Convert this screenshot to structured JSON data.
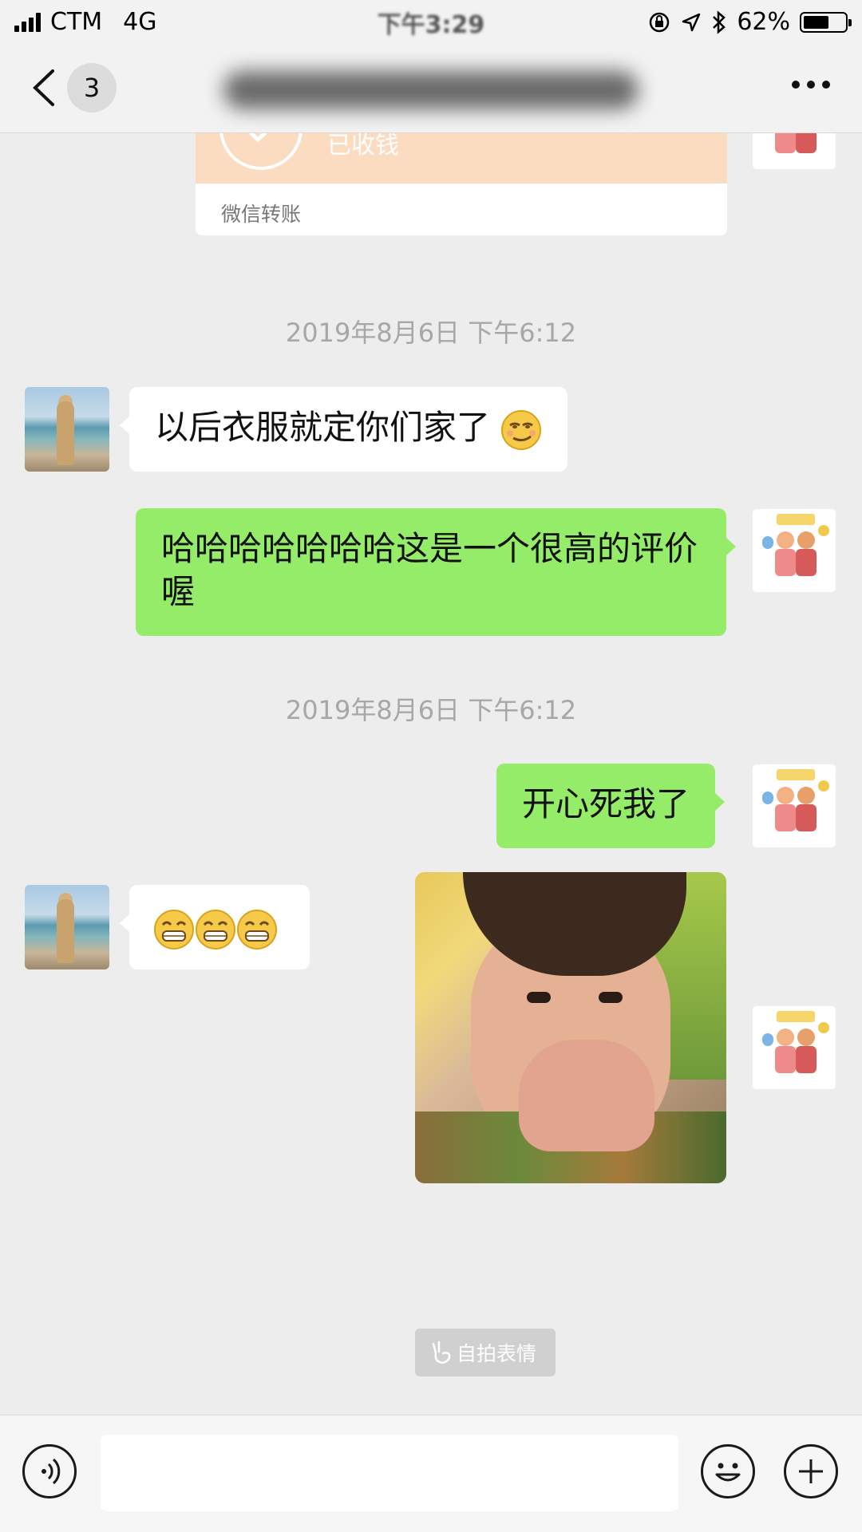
{
  "status_bar": {
    "carrier": "CTM",
    "network": "4G",
    "time": "下午3:29",
    "battery_percent": "62%",
    "battery_level": 0.62
  },
  "header": {
    "unread_count": "3",
    "back_icon": "chevron-left-icon",
    "more_icon": "more-dots-icon"
  },
  "transfer": {
    "status": "已收钱",
    "label": "微信转账",
    "color": "#fcdcc0"
  },
  "messages": {
    "timestamp_1": "2019年8月6日 下午6:12",
    "msg_1_text": "以后衣服就定你们家了",
    "msg_1_emoji": "smirk-emoji",
    "msg_2_text": "哈哈哈哈哈哈哈这是一个很高的评价喔",
    "timestamp_2": "2019年8月6日 下午6:12",
    "msg_3_text": "开心死我了",
    "msg_4_emojis": [
      "grin-emoji",
      "grin-emoji",
      "grin-emoji"
    ],
    "msg_5_sticker": "selfie-sticker",
    "selfie_tag_label": "自拍表情"
  },
  "colors": {
    "outgoing_bubble": "#95ec69",
    "incoming_bubble": "#ffffff",
    "background": "#ededed",
    "timestamp": "#a7a7a7"
  },
  "input_bar": {
    "voice_icon": "voice-icon",
    "emoji_icon": "emoji-icon",
    "plus_icon": "plus-circle-icon",
    "placeholder": ""
  }
}
